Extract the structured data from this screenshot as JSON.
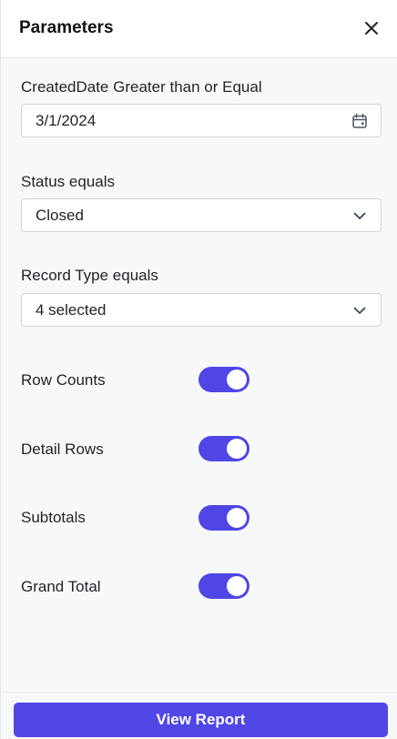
{
  "panel": {
    "title": "Parameters",
    "close_icon": "close-icon"
  },
  "fields": [
    {
      "label": "CreatedDate Greater than or Equal",
      "value": "3/1/2024",
      "icon": "calendar-icon"
    },
    {
      "label": "Status equals",
      "value": "Closed",
      "icon": "chevron-down-icon"
    },
    {
      "label": "Record Type equals",
      "value": "4 selected",
      "icon": "chevron-down-icon"
    }
  ],
  "toggles": [
    {
      "label": "Row Counts",
      "on": true
    },
    {
      "label": "Detail Rows",
      "on": true
    },
    {
      "label": "Subtotals",
      "on": true
    },
    {
      "label": "Grand Total",
      "on": true
    }
  ],
  "footer": {
    "button_label": "View Report"
  },
  "colors": {
    "accent": "#4f46e5",
    "panel_bg": "#f7f8fa",
    "border": "#cfd3d8"
  }
}
